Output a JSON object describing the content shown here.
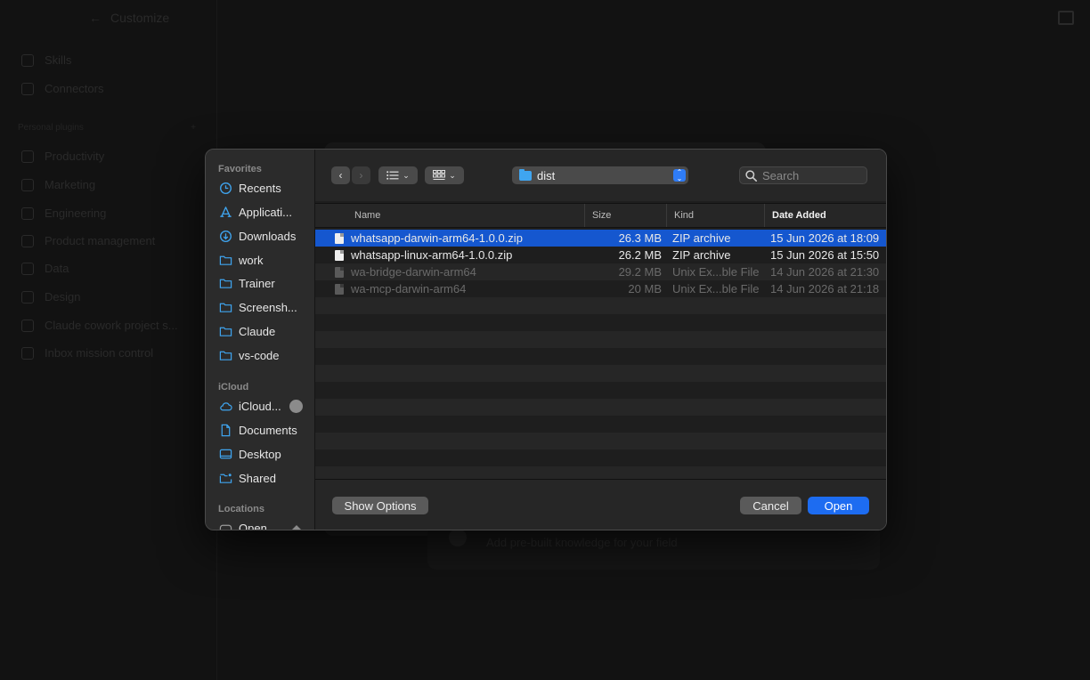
{
  "background": {
    "title": "Customize",
    "nav": [
      {
        "label": "Skills"
      },
      {
        "label": "Connectors"
      }
    ],
    "section_label": "Personal plugins",
    "plugins": [
      {
        "label": "Productivity"
      },
      {
        "label": "Marketing"
      },
      {
        "label": "Engineering"
      },
      {
        "label": "Product management"
      },
      {
        "label": "Data"
      },
      {
        "label": "Design"
      },
      {
        "label": "Claude cowork project s..."
      },
      {
        "label": "Inbox mission control"
      }
    ],
    "card_text": "Add pre-built knowledge for your field"
  },
  "sidebar": {
    "favorites_label": "Favorites",
    "favorites": [
      {
        "label": "Recents",
        "icon": "clock-icon"
      },
      {
        "label": "Applicati...",
        "icon": "applications-icon"
      },
      {
        "label": "Downloads",
        "icon": "download-icon"
      },
      {
        "label": "work",
        "icon": "folder-icon"
      },
      {
        "label": "Trainer",
        "icon": "folder-icon"
      },
      {
        "label": "Screensh...",
        "icon": "folder-icon"
      },
      {
        "label": "Claude",
        "icon": "folder-icon"
      },
      {
        "label": "vs-code",
        "icon": "folder-icon"
      }
    ],
    "icloud_label": "iCloud",
    "icloud": [
      {
        "label": "iCloud...",
        "icon": "cloud-icon"
      },
      {
        "label": "Documents",
        "icon": "document-icon"
      },
      {
        "label": "Desktop",
        "icon": "desktop-icon"
      },
      {
        "label": "Shared",
        "icon": "shared-folder-icon"
      }
    ],
    "locations_label": "Locations",
    "locations": [
      {
        "label": "Open",
        "icon": "disk-icon"
      }
    ]
  },
  "toolbar": {
    "path": "dist",
    "search_placeholder": "Search"
  },
  "columns": {
    "name": "Name",
    "size": "Size",
    "kind": "Kind",
    "date": "Date Added"
  },
  "files": [
    {
      "name": "whatsapp-darwin-arm64-1.0.0.zip",
      "size": "26.3 MB",
      "kind": "ZIP archive",
      "date": "15 Jun 2026 at 18:09",
      "selected": true,
      "enabled": true
    },
    {
      "name": "whatsapp-linux-arm64-1.0.0.zip",
      "size": "26.2 MB",
      "kind": "ZIP archive",
      "date": "15 Jun 2026 at 15:50",
      "selected": false,
      "enabled": true
    },
    {
      "name": "wa-bridge-darwin-arm64",
      "size": "29.2 MB",
      "kind": "Unix Ex...ble File",
      "date": "14 Jun 2026 at 21:30",
      "selected": false,
      "enabled": false
    },
    {
      "name": "wa-mcp-darwin-arm64",
      "size": "20 MB",
      "kind": "Unix Ex...ble File",
      "date": "14 Jun 2026 at 21:18",
      "selected": false,
      "enabled": false
    }
  ],
  "footer": {
    "options_label": "Show Options",
    "cancel_label": "Cancel",
    "open_label": "Open"
  },
  "colors": {
    "accent": "#1d6cf1",
    "selection": "#1557cf",
    "folder": "#3fa5f0"
  }
}
